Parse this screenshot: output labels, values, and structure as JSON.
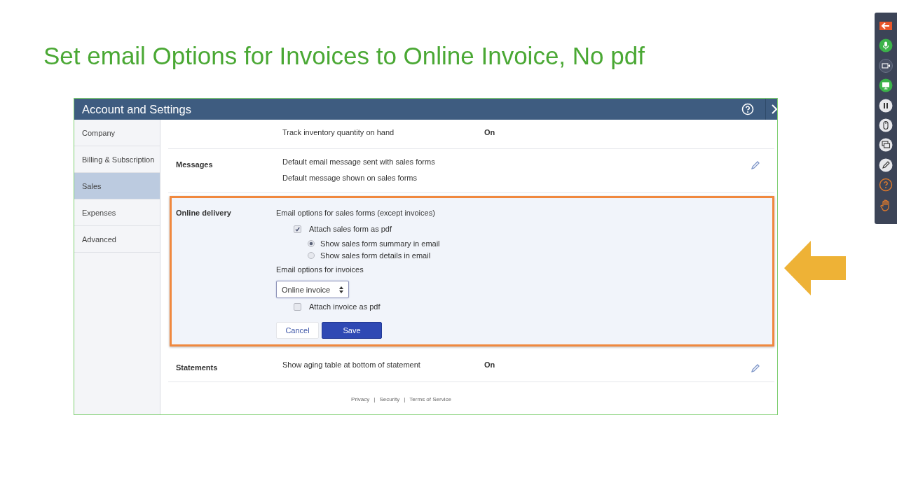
{
  "slide_title": "Set email Options for Invoices to Online Invoice, No pdf",
  "settings": {
    "title": "Account and Settings",
    "sidebar": [
      {
        "label": "Company",
        "selected": false
      },
      {
        "label": "Billing & Subscription",
        "selected": false
      },
      {
        "label": "Sales",
        "selected": true
      },
      {
        "label": "Expenses",
        "selected": false
      },
      {
        "label": "Advanced",
        "selected": false
      }
    ],
    "sections": [
      {
        "kind": "info",
        "lines": [
          {
            "text": "Track inventory quantity on hand",
            "value": "On"
          }
        ]
      },
      {
        "kind": "info",
        "label": "Messages",
        "editable": true,
        "lines": [
          {
            "text": "Default email message sent with sales forms"
          },
          {
            "text": "Default message shown on sales forms"
          }
        ]
      },
      {
        "kind": "form",
        "highlighted": true,
        "label": "Online delivery",
        "items": [
          {
            "kind": "heading",
            "text": "Email options for sales forms (except invoices)"
          },
          {
            "kind": "checkbox",
            "text": "Attach sales form as pdf",
            "checked": true
          },
          {
            "kind": "radio",
            "text": "Show sales form summary in email",
            "selected": true
          },
          {
            "kind": "radio",
            "text": "Show sales form details in email",
            "selected": false
          },
          {
            "kind": "heading",
            "text": "Email options for invoices"
          },
          {
            "kind": "select",
            "value": "Online invoice"
          },
          {
            "kind": "checkbox",
            "text": "Attach invoice as pdf",
            "checked": false
          }
        ],
        "buttons": [
          {
            "label": "Cancel",
            "kind": "secondary"
          },
          {
            "label": "Save",
            "kind": "primary"
          }
        ]
      },
      {
        "kind": "info",
        "label": "Statements",
        "editable": true,
        "lines": [
          {
            "text": "Show aging table at bottom of statement",
            "value": "On"
          }
        ]
      }
    ],
    "footer_links": [
      "Privacy",
      "Security",
      "Terms of Service"
    ],
    "footer_separator": "|"
  },
  "recorder_toolbar": [
    {
      "kind": "back",
      "on": true
    },
    {
      "kind": "mic",
      "on": true
    },
    {
      "kind": "camera",
      "on": false
    },
    {
      "kind": "screen",
      "on": true
    },
    {
      "kind": "pause",
      "on": false
    },
    {
      "kind": "mouse",
      "on": false
    },
    {
      "kind": "windows",
      "on": false
    },
    {
      "kind": "pen",
      "on": false
    },
    {
      "kind": "help",
      "on": false
    },
    {
      "kind": "hand",
      "on": false
    }
  ]
}
